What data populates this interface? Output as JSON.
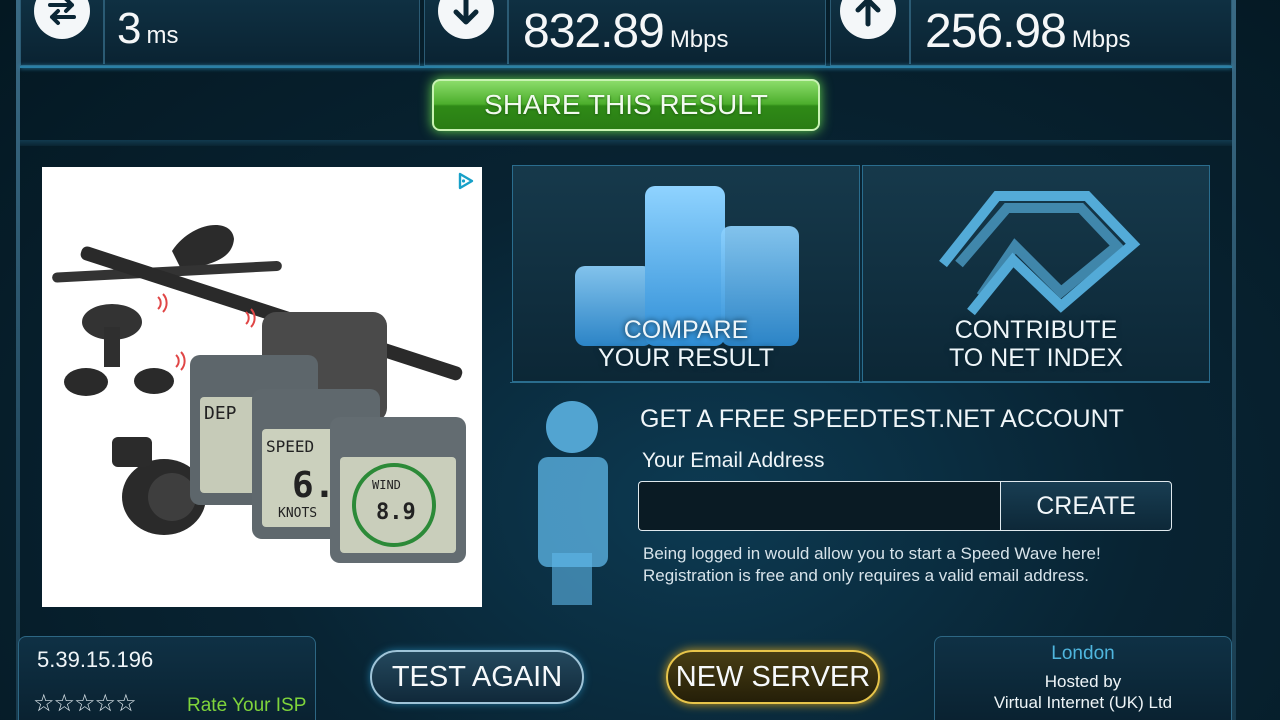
{
  "stats": {
    "ping": {
      "value": "3",
      "unit": "ms",
      "icon": "ping-arrows-icon"
    },
    "download": {
      "value": "832.89",
      "unit": "Mbps",
      "icon": "download-arrow-icon"
    },
    "upload": {
      "value": "256.98",
      "unit": "Mbps",
      "icon": "upload-arrow-icon"
    }
  },
  "share_label": "SHARE THIS RESULT",
  "tiles": {
    "compare": {
      "line1": "COMPARE",
      "line2": "YOUR RESULT"
    },
    "contribute": {
      "line1": "CONTRIBUTE",
      "line2": "TO NET INDEX"
    }
  },
  "account": {
    "title": "GET A FREE SPEEDTEST.NET ACCOUNT",
    "email_label": "Your Email Address",
    "email_value": "",
    "create_label": "CREATE",
    "note_line1": "Being logged in would allow you to start a Speed Wave here!",
    "note_line2": "Registration is free and only requires a valid email address."
  },
  "ad": {
    "icon": "adchoices-icon",
    "display_labels": [
      "DEP",
      "SPEED",
      "6.",
      "KNOTS",
      "WIND",
      "8.9"
    ]
  },
  "footer": {
    "ip": "5.39.15.196",
    "rating": {
      "stars": 0,
      "max": 5
    },
    "rate_label": "Rate Your ISP",
    "test_again_label": "TEST AGAIN",
    "new_server_label": "NEW SERVER",
    "city": "London",
    "hosted_by_label": "Hosted by",
    "host": "Virtual Internet (UK) Ltd"
  },
  "colors": {
    "share_green": "#4cae2c",
    "server_gold": "#e8c54a",
    "accent_blue": "#2a7fa5",
    "rate_green": "#7fd43b",
    "city_blue": "#4fb6de"
  }
}
